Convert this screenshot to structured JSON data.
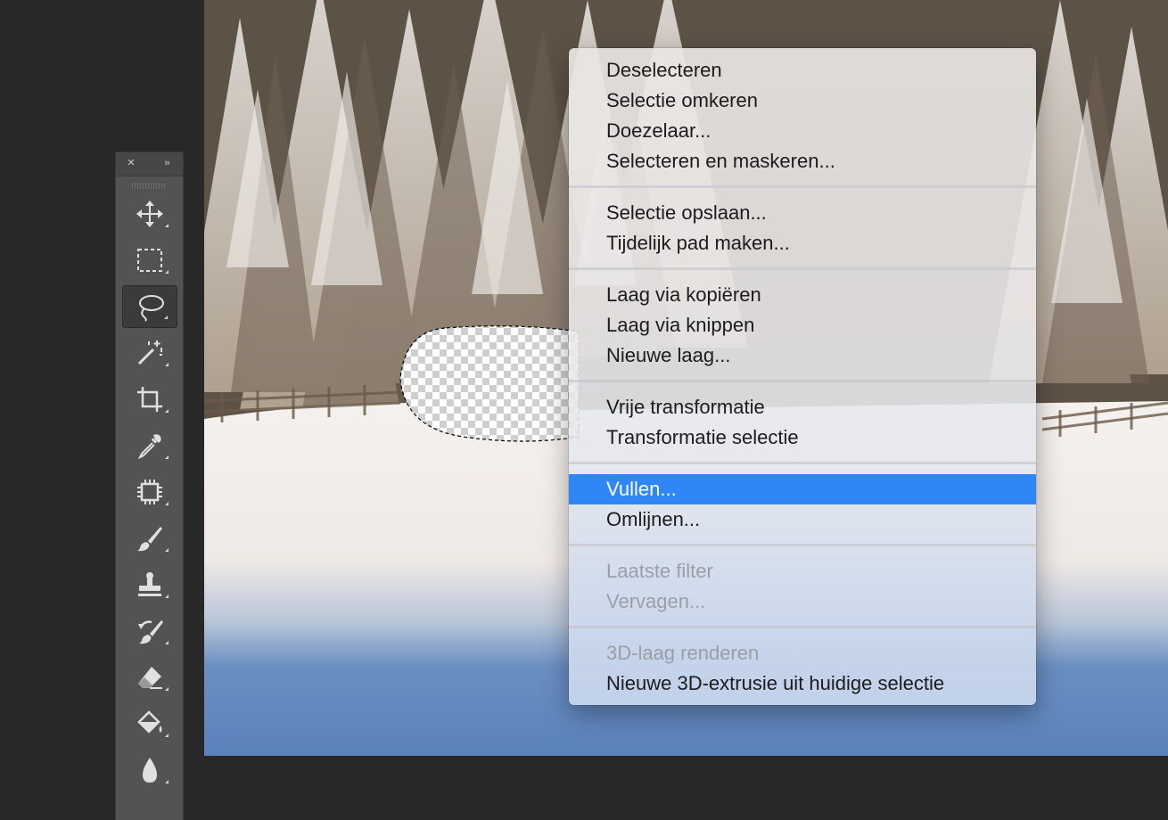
{
  "tools_panel": {
    "close_glyph": "×",
    "collapse_glyph": "››",
    "tools": [
      {
        "id": "move",
        "icon": "move-tool-icon",
        "active": false
      },
      {
        "id": "marquee",
        "icon": "rectangular-marquee-icon",
        "active": false
      },
      {
        "id": "lasso",
        "icon": "lasso-icon",
        "active": true
      },
      {
        "id": "magic-wand",
        "icon": "magic-wand-icon",
        "active": false
      },
      {
        "id": "crop",
        "icon": "crop-icon",
        "active": false
      },
      {
        "id": "eyedropper",
        "icon": "eyedropper-icon",
        "active": false
      },
      {
        "id": "spot-healing",
        "icon": "healing-patch-icon",
        "active": false
      },
      {
        "id": "brush",
        "icon": "brush-icon",
        "active": false
      },
      {
        "id": "clone-stamp",
        "icon": "clone-stamp-icon",
        "active": false
      },
      {
        "id": "history-brush",
        "icon": "history-brush-icon",
        "active": false
      },
      {
        "id": "eraser",
        "icon": "eraser-icon",
        "active": false
      },
      {
        "id": "paint-bucket",
        "icon": "paint-bucket-icon",
        "active": false
      },
      {
        "id": "blur",
        "icon": "blur-drop-icon",
        "active": false
      }
    ]
  },
  "context_menu": {
    "groups": [
      {
        "items": [
          {
            "label": "Deselecteren",
            "disabled": false,
            "highlighted": false
          },
          {
            "label": "Selectie omkeren",
            "disabled": false,
            "highlighted": false
          },
          {
            "label": "Doezelaar...",
            "disabled": false,
            "highlighted": false
          },
          {
            "label": "Selecteren en maskeren...",
            "disabled": false,
            "highlighted": false
          }
        ]
      },
      {
        "items": [
          {
            "label": "Selectie opslaan...",
            "disabled": false,
            "highlighted": false
          },
          {
            "label": "Tijdelijk pad maken...",
            "disabled": false,
            "highlighted": false
          }
        ]
      },
      {
        "items": [
          {
            "label": "Laag via kopiëren",
            "disabled": false,
            "highlighted": false
          },
          {
            "label": "Laag via knippen",
            "disabled": false,
            "highlighted": false
          },
          {
            "label": "Nieuwe laag...",
            "disabled": false,
            "highlighted": false
          }
        ]
      },
      {
        "items": [
          {
            "label": "Vrije transformatie",
            "disabled": false,
            "highlighted": false
          },
          {
            "label": "Transformatie selectie",
            "disabled": false,
            "highlighted": false
          }
        ]
      },
      {
        "items": [
          {
            "label": "Vullen...",
            "disabled": false,
            "highlighted": true
          },
          {
            "label": "Omlijnen...",
            "disabled": false,
            "highlighted": false
          }
        ]
      },
      {
        "items": [
          {
            "label": "Laatste filter",
            "disabled": true,
            "highlighted": false
          },
          {
            "label": "Vervagen...",
            "disabled": true,
            "highlighted": false
          }
        ]
      },
      {
        "items": [
          {
            "label": "3D-laag renderen",
            "disabled": true,
            "highlighted": false
          },
          {
            "label": "Nieuwe 3D-extrusie uit huidige selectie",
            "disabled": false,
            "highlighted": false
          }
        ]
      }
    ]
  },
  "colors": {
    "menu_highlight": "#2f86f5",
    "panel_bg": "#535353",
    "workspace_bg": "#282828"
  }
}
